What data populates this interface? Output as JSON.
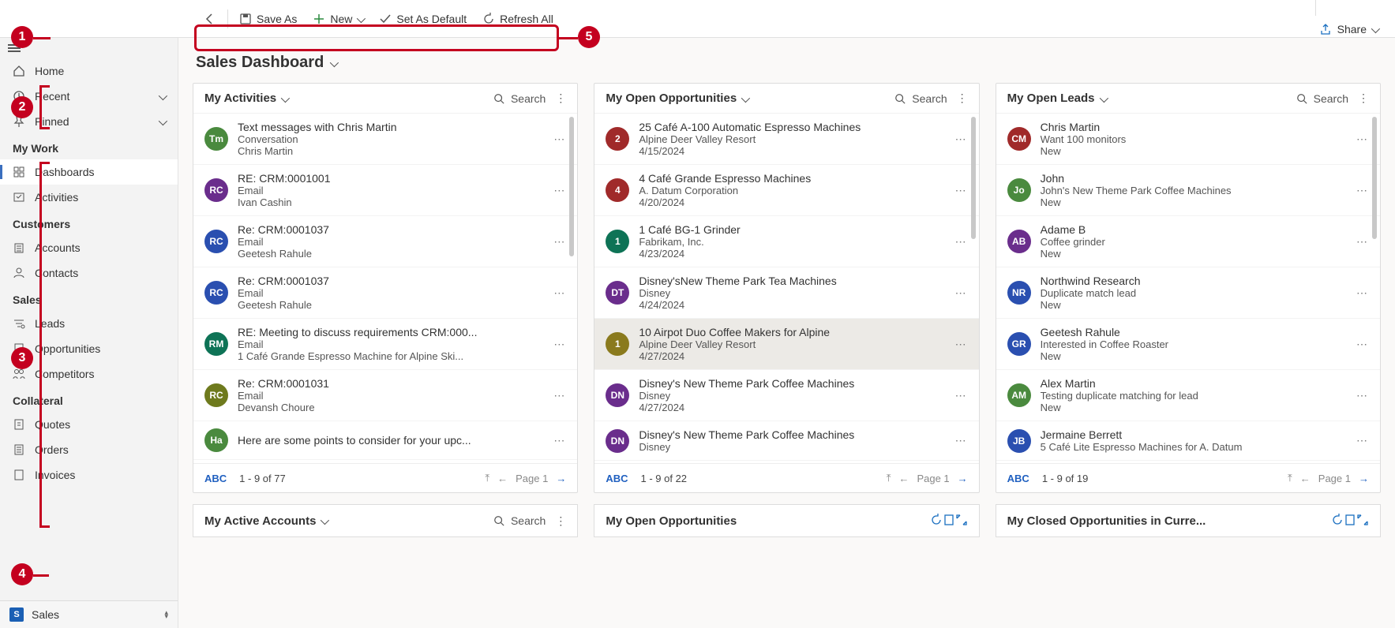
{
  "toolbar": {
    "saveAs": "Save As",
    "new": "New",
    "setDefault": "Set As Default",
    "refresh": "Refresh All",
    "share": "Share"
  },
  "sidebar": {
    "home": "Home",
    "recent": "Recent",
    "pinned": "Pinned",
    "sections": {
      "myWork": "My Work",
      "customers": "Customers",
      "sales": "Sales",
      "collateral": "Collateral"
    },
    "items": {
      "dashboards": "Dashboards",
      "activities": "Activities",
      "accounts": "Accounts",
      "contacts": "Contacts",
      "leads": "Leads",
      "opportunities": "Opportunities",
      "competitors": "Competitors",
      "quotes": "Quotes",
      "orders": "Orders",
      "invoices": "Invoices"
    },
    "area": "Sales"
  },
  "page": {
    "title": "Sales Dashboard"
  },
  "cards": {
    "activities": {
      "title": "My Activities",
      "search": "Search",
      "footer": {
        "abc": "ABC",
        "range": "1 - 9 of 77",
        "page": "Page 1"
      },
      "rows": [
        {
          "avatar": "Tm",
          "color": "#4a8a3e",
          "l1": "Text messages with Chris Martin",
          "l2": "Conversation",
          "l3": "Chris Martin"
        },
        {
          "avatar": "RC",
          "color": "#6a2d8c",
          "l1": "RE: CRM:0001001",
          "l2": "Email",
          "l3": "Ivan Cashin"
        },
        {
          "avatar": "RC",
          "color": "#2a4fb0",
          "l1": "Re: CRM:0001037",
          "l2": "Email",
          "l3": "Geetesh Rahule"
        },
        {
          "avatar": "RC",
          "color": "#2a4fb0",
          "l1": "Re: CRM:0001037",
          "l2": "Email",
          "l3": "Geetesh Rahule"
        },
        {
          "avatar": "RM",
          "color": "#0e7356",
          "l1": "RE: Meeting to discuss requirements CRM:000...",
          "l2": "Email",
          "l3": "1 Café Grande Espresso Machine for Alpine Ski..."
        },
        {
          "avatar": "RC",
          "color": "#6e7a1d",
          "l1": "Re: CRM:0001031",
          "l2": "Email",
          "l3": "Devansh Choure"
        },
        {
          "avatar": "Ha",
          "color": "#4a8a3e",
          "l1": "Here are some points to consider for your upc...",
          "l2": "",
          "l3": ""
        }
      ]
    },
    "opps": {
      "title": "My Open Opportunities",
      "search": "Search",
      "footer": {
        "abc": "ABC",
        "range": "1 - 9 of 22",
        "page": "Page 1"
      },
      "rows": [
        {
          "avatar": "2",
          "color": "#a02a2a",
          "l1": "25 Café A-100 Automatic Espresso Machines",
          "l2": "Alpine Deer Valley Resort",
          "l3": "4/15/2024"
        },
        {
          "avatar": "4",
          "color": "#a02a2a",
          "l1": "4 Café Grande Espresso Machines",
          "l2": "A. Datum Corporation",
          "l3": "4/20/2024"
        },
        {
          "avatar": "1",
          "color": "#0e7356",
          "l1": "1 Café BG-1 Grinder",
          "l2": "Fabrikam, Inc.",
          "l3": "4/23/2024"
        },
        {
          "avatar": "DT",
          "color": "#6a2d8c",
          "l1": "Disney'sNew Theme Park Tea Machines",
          "l2": "Disney",
          "l3": "4/24/2024"
        },
        {
          "avatar": "1",
          "color": "#8a7a1d",
          "l1": "10 Airpot Duo Coffee Makers for Alpine",
          "l2": "Alpine Deer Valley Resort",
          "l3": "4/27/2024",
          "selected": true
        },
        {
          "avatar": "DN",
          "color": "#6a2d8c",
          "l1": "Disney's New Theme Park Coffee Machines",
          "l2": "Disney",
          "l3": "4/27/2024"
        },
        {
          "avatar": "DN",
          "color": "#6a2d8c",
          "l1": "Disney's New Theme Park Coffee Machines",
          "l2": "Disney",
          "l3": ""
        }
      ]
    },
    "leads": {
      "title": "My Open Leads",
      "search": "Search",
      "footer": {
        "abc": "ABC",
        "range": "1 - 9 of 19",
        "page": "Page 1"
      },
      "rows": [
        {
          "avatar": "CM",
          "color": "#a02a2a",
          "l1": "Chris Martin",
          "l2": "Want 100 monitors",
          "l3": "New"
        },
        {
          "avatar": "Jo",
          "color": "#4a8a3e",
          "l1": "John",
          "l2": "John's New Theme Park Coffee Machines",
          "l3": "New"
        },
        {
          "avatar": "AB",
          "color": "#6a2d8c",
          "l1": "Adame B",
          "l2": "Coffee grinder",
          "l3": "New"
        },
        {
          "avatar": "NR",
          "color": "#2a4fb0",
          "l1": "Northwind Research",
          "l2": "Duplicate match lead",
          "l3": "New"
        },
        {
          "avatar": "GR",
          "color": "#2a4fb0",
          "l1": "Geetesh Rahule",
          "l2": "Interested in Coffee Roaster",
          "l3": "New"
        },
        {
          "avatar": "AM",
          "color": "#4a8a3e",
          "l1": "Alex Martin",
          "l2": "Testing duplicate matching for lead",
          "l3": "New"
        },
        {
          "avatar": "JB",
          "color": "#2a4fb0",
          "l1": "Jermaine Berrett",
          "l2": "5 Café Lite Espresso Machines for A. Datum",
          "l3": ""
        }
      ]
    }
  },
  "cards2": {
    "accounts": {
      "title": "My Active Accounts",
      "search": "Search"
    },
    "opps2": {
      "title": "My Open Opportunities"
    },
    "closed": {
      "title": "My Closed Opportunities in Curre..."
    }
  },
  "callouts": [
    "1",
    "2",
    "3",
    "4",
    "5"
  ]
}
